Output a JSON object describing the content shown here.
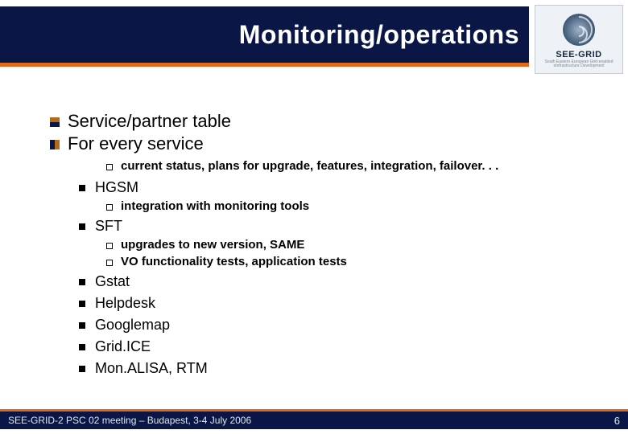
{
  "header": {
    "title": "Monitoring/operations",
    "logo_label": "SEE-GRID",
    "logo_sub": "South Eastern European Grid-enabled eInfrastructure Development"
  },
  "body": {
    "line1": "Service/partner table",
    "line2": "For every service",
    "sub_a": "current status, plans for upgrade, features, integration, failover. . .",
    "item_hgsm": "HGSM",
    "hgsm_sub": "integration with monitoring tools",
    "item_sft": "SFT",
    "sft_sub1": "upgrades to new version, SAME",
    "sft_sub2": "VO functionality tests, application tests",
    "item_gstat": "Gstat",
    "item_helpdesk": "Helpdesk",
    "item_googlemap": "Googlemap",
    "item_gridice": "Grid.ICE",
    "item_monalisa": "Mon.ALISA, RTM"
  },
  "footer": {
    "text": "SEE-GRID-2 PSC 02 meeting – Budapest, 3-4 July 2006",
    "page": "6"
  }
}
